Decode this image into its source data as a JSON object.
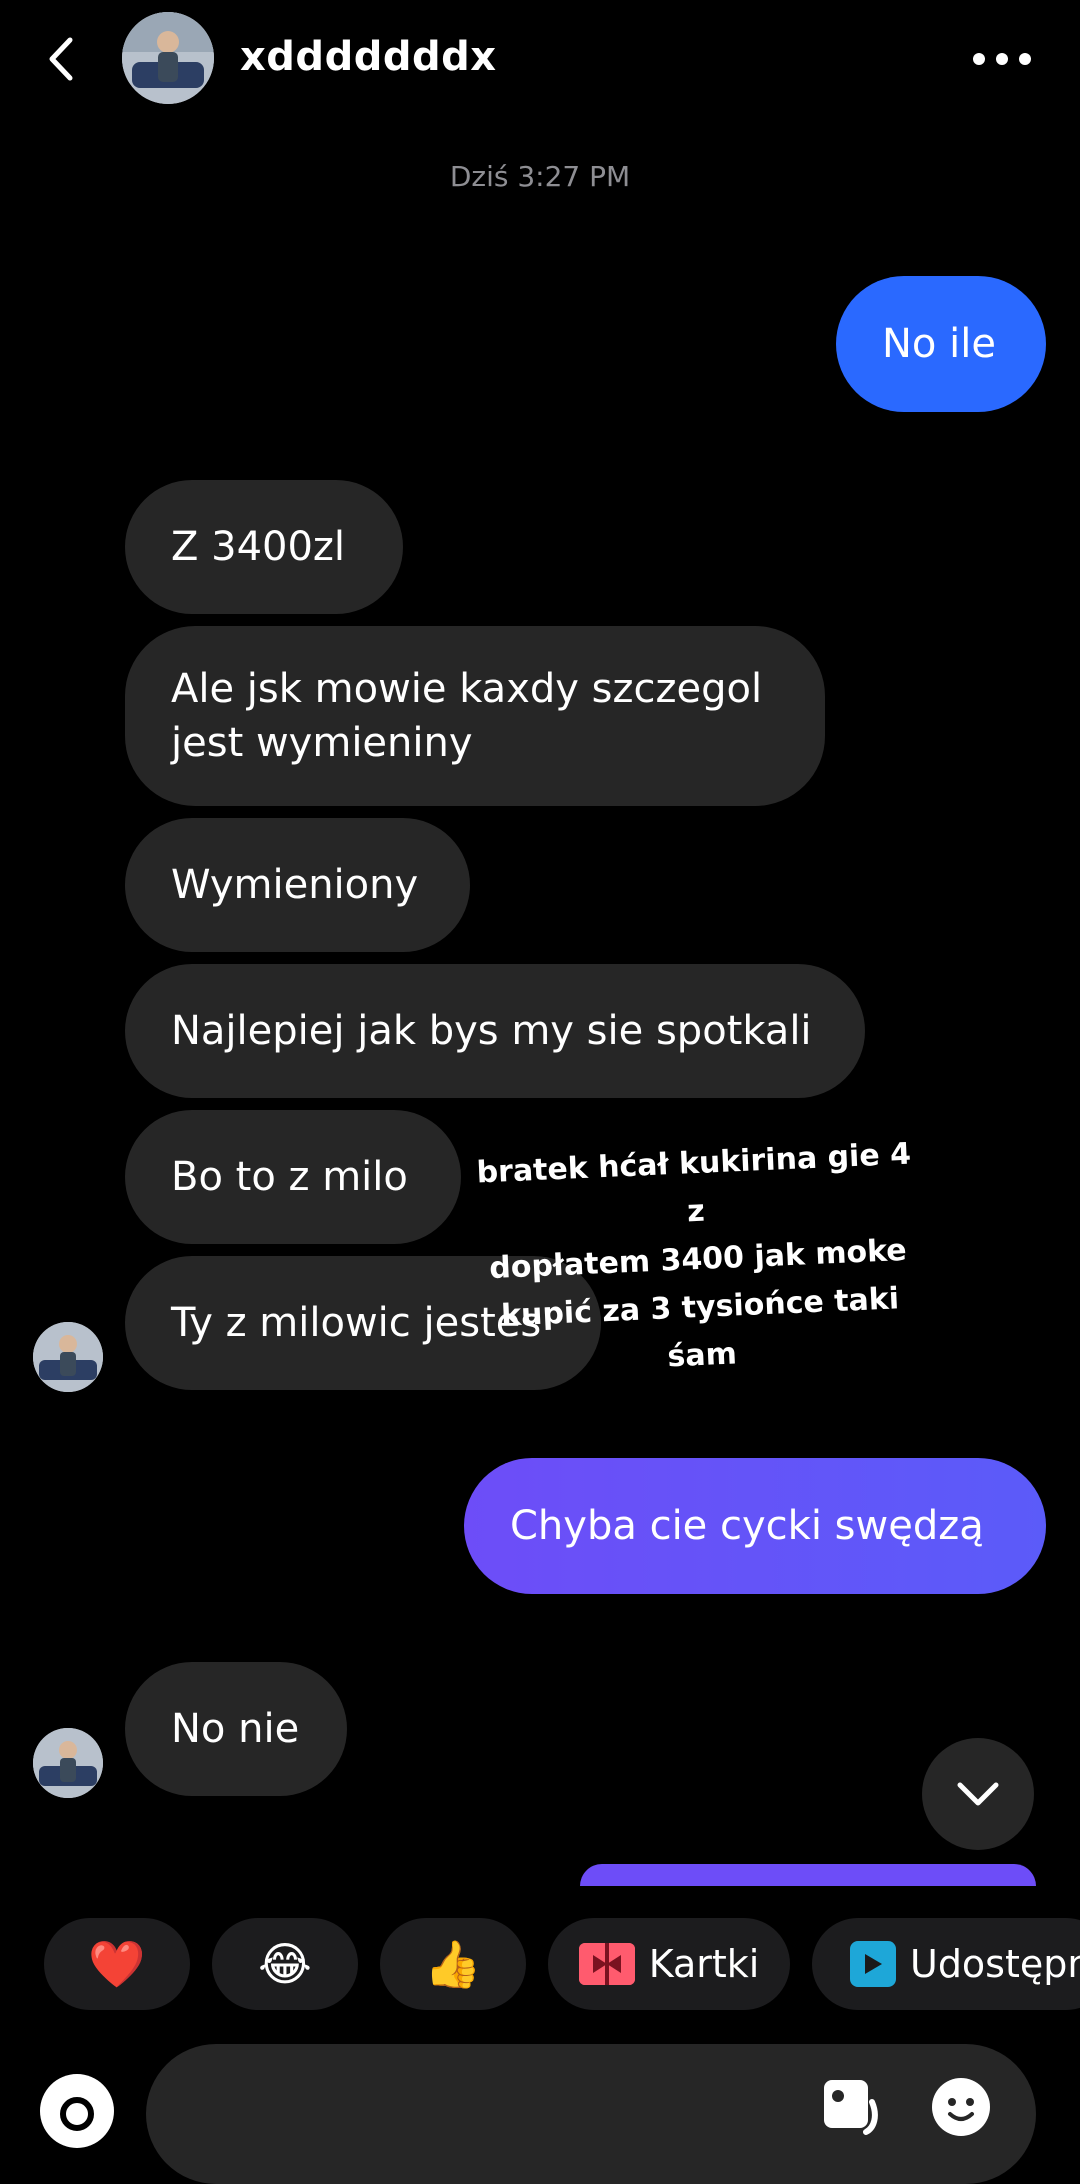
{
  "header": {
    "username": "xdddddddx"
  },
  "timestamp": "Dziś 3:27 PM",
  "messages": [
    {
      "text": "No ile",
      "side": "sent"
    },
    {
      "text": "Z 3400zl",
      "side": "received"
    },
    {
      "text": "Ale jsk mowie kaxdy szczegol jest wymieniny",
      "side": "received"
    },
    {
      "text": "Wymieniony",
      "side": "received"
    },
    {
      "text": "Najlepiej jak bys my sie spotkali",
      "side": "received"
    },
    {
      "text": "Bo to z milo",
      "side": "received"
    },
    {
      "text": "Ty z milowic jestes",
      "side": "received"
    },
    {
      "text": "Chyba cie cycki swędzą",
      "side": "sent"
    },
    {
      "text": "No nie",
      "side": "received"
    }
  ],
  "overlay": {
    "line1": "bratek hćał kukirina gie 4 z",
    "line2": "dopłatem 3400 jak moke",
    "line3": "kupić za 3 tysiońce taki śam"
  },
  "reactions": [
    {
      "icon": "heart-emoji",
      "glyph": "❤️"
    },
    {
      "icon": "laughing-emoji",
      "glyph": "😂"
    },
    {
      "icon": "thumbs-up-emoji",
      "glyph": "👍"
    },
    {
      "icon": "gift-card-icon",
      "label": "Kartki"
    },
    {
      "icon": "share-play-icon",
      "label": "Udostępn"
    }
  ],
  "colors": {
    "background": "#000000",
    "received_bubble": "#262626",
    "sent_blue": "#2a69ff",
    "sent_purple": "#6d4df8",
    "timestamp": "#8e8e93"
  }
}
